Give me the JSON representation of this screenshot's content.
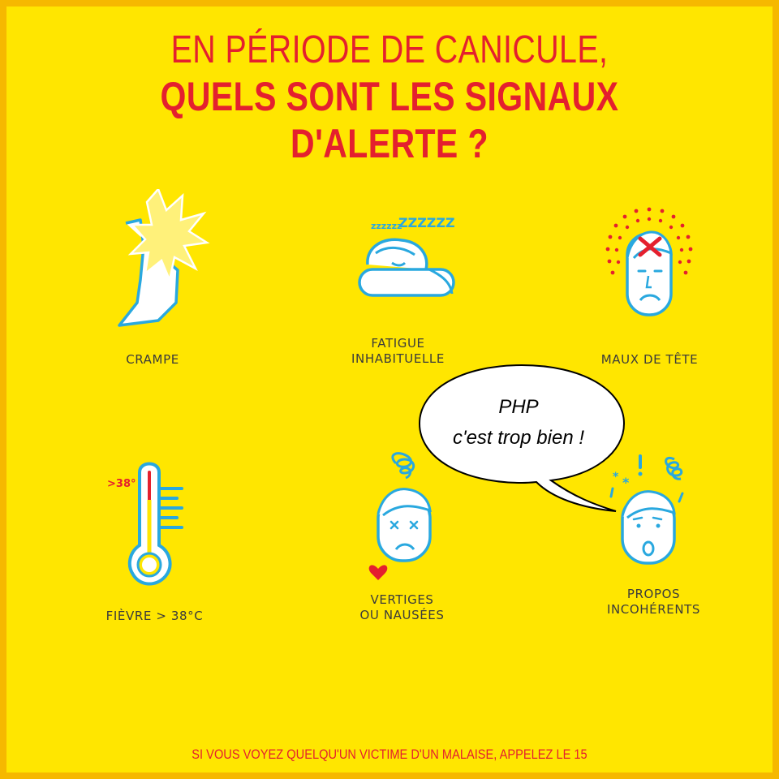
{
  "header": {
    "line1": "EN PÉRIODE DE CANICULE,",
    "line2": "QUELS SONT LES SIGNAUX D'ALERTE ?"
  },
  "symptoms": [
    {
      "label": "CRAMPE",
      "icon": "cramp-foot-icon"
    },
    {
      "label": "FATIGUE\nINHABITUELLE",
      "icon": "sleeping-icon"
    },
    {
      "label": "MAUX DE TÊTE",
      "icon": "headache-icon"
    },
    {
      "label": "FIÈVRE > 38°C",
      "icon": "thermometer-icon"
    },
    {
      "label": "VERTIGES\nOU NAUSÉES",
      "icon": "dizzy-face-icon"
    },
    {
      "label": "PROPOS\nINCOHÉRENTS",
      "icon": "confused-face-icon"
    }
  ],
  "thermometer_text": ">38°",
  "speech_bubble": {
    "line1": "PHP",
    "line2": "c'est trop bien !"
  },
  "footer": "SI VOUS VOYEZ QUELQU'UN VICTIME D'UN MALAISE, APPELEZ LE 15",
  "colors": {
    "background": "#FFE600",
    "border": "#F6B800",
    "accent_red": "#E4202E",
    "icon_blue": "#29A8DF"
  }
}
